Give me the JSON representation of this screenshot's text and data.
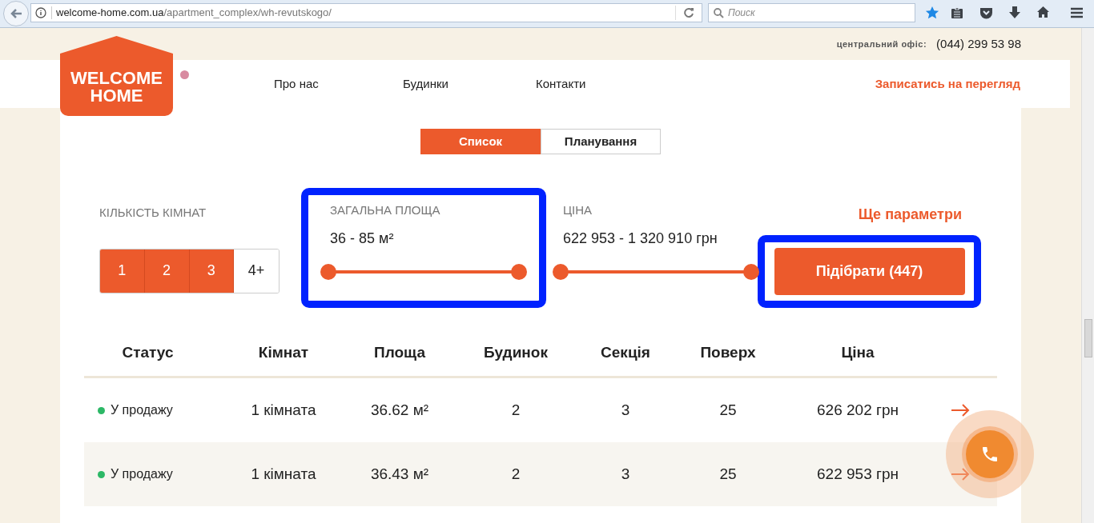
{
  "browser": {
    "url_host": "welcome-home.com.ua",
    "url_path": "/apartment_complex/wh-revutskogo/",
    "search": {
      "placeholder": "Поиск"
    }
  },
  "header": {
    "office_label": "центральний офіс:",
    "office_phone": "(044) 299 53 98",
    "logo": [
      "WELCOME",
      "HOME"
    ],
    "nav": [
      "Про нас",
      "Будинки",
      "Контакти"
    ],
    "cta": "Записатись на перегляд"
  },
  "view_tabs": [
    {
      "label": "Список",
      "selected": true
    },
    {
      "label": "Планування",
      "selected": false
    }
  ],
  "filters": {
    "rooms": {
      "label": "КІЛЬКІСТЬ КІМНАТ",
      "options": [
        {
          "label": "1",
          "selected": true
        },
        {
          "label": "2",
          "selected": true
        },
        {
          "label": "3",
          "selected": true
        },
        {
          "label": "4+",
          "selected": false
        }
      ]
    },
    "area": {
      "label": "ЗАГАЛЬНА ПЛОЩА",
      "value": "36 - 85 м²",
      "highlighted": true
    },
    "price": {
      "label": "ЦІНА",
      "value": "622 953 - 1 320 910 грн",
      "highlighted": false
    },
    "more_link": "Ще параметри",
    "submit": {
      "label": "Підібрати (447)",
      "highlighted": true
    }
  },
  "table": {
    "columns": [
      "Статус",
      "Кімнат",
      "Площа",
      "Будинок",
      "Секція",
      "Поверх",
      "Ціна"
    ],
    "rows": [
      {
        "color": "#2cb866",
        "cells": [
          "У продажу",
          "1 кімната",
          "36.62 м²",
          "2",
          "3",
          "25",
          "626 202 грн"
        ]
      },
      {
        "color": "#2cb866",
        "cells": [
          "У продажу",
          "1 кімната",
          "36.43 м²",
          "2",
          "3",
          "25",
          "622 953 грн"
        ]
      }
    ]
  }
}
